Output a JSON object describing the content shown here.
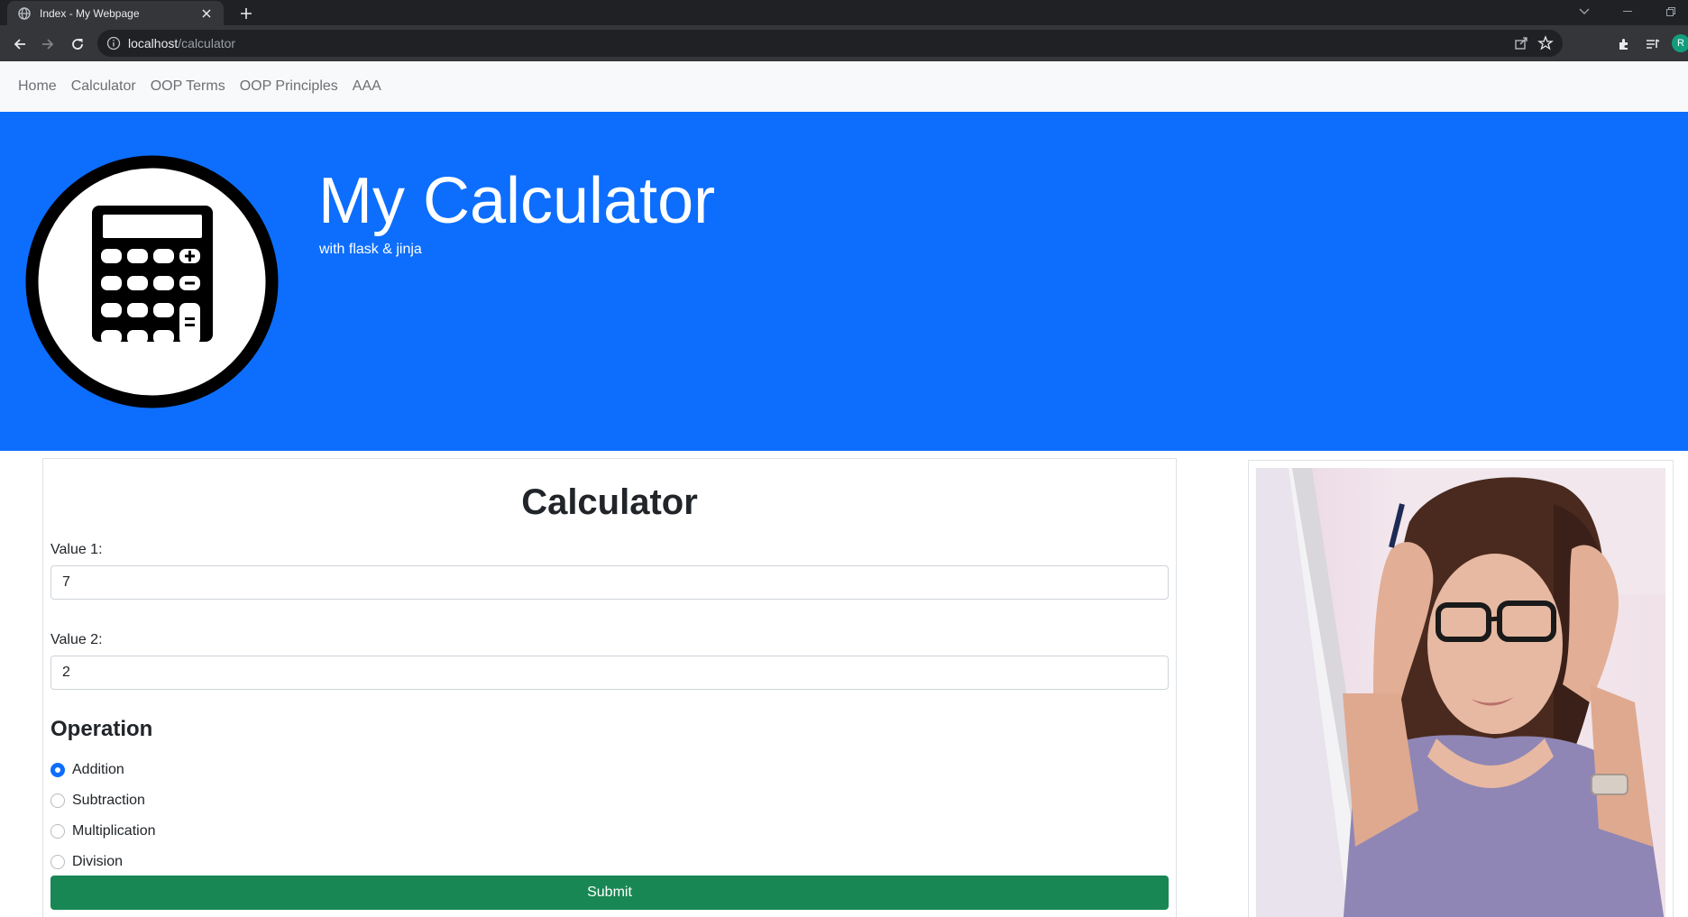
{
  "browser": {
    "tab_title": "Index - My Webpage",
    "url_host": "localhost",
    "url_path": "/calculator",
    "avatar_letter": "R"
  },
  "nav": {
    "items": [
      "Home",
      "Calculator",
      "OOP Terms",
      "OOP Principles",
      "AAA"
    ]
  },
  "hero": {
    "title": "My Calculator",
    "subtitle": "with flask & jinja",
    "background": "#0d6efd",
    "logo_icon": "calculator-icon"
  },
  "form": {
    "heading": "Calculator",
    "value1_label": "Value 1:",
    "value1": "7",
    "value2_label": "Value 2:",
    "value2": "2",
    "operation_heading": "Operation",
    "operations": [
      "Addition",
      "Subtraction",
      "Multiplication",
      "Division"
    ],
    "selected_operation": "Addition",
    "submit_label": "Submit",
    "submit_color": "#198754"
  },
  "photo": {
    "subject": "stressed-woman-photo"
  }
}
